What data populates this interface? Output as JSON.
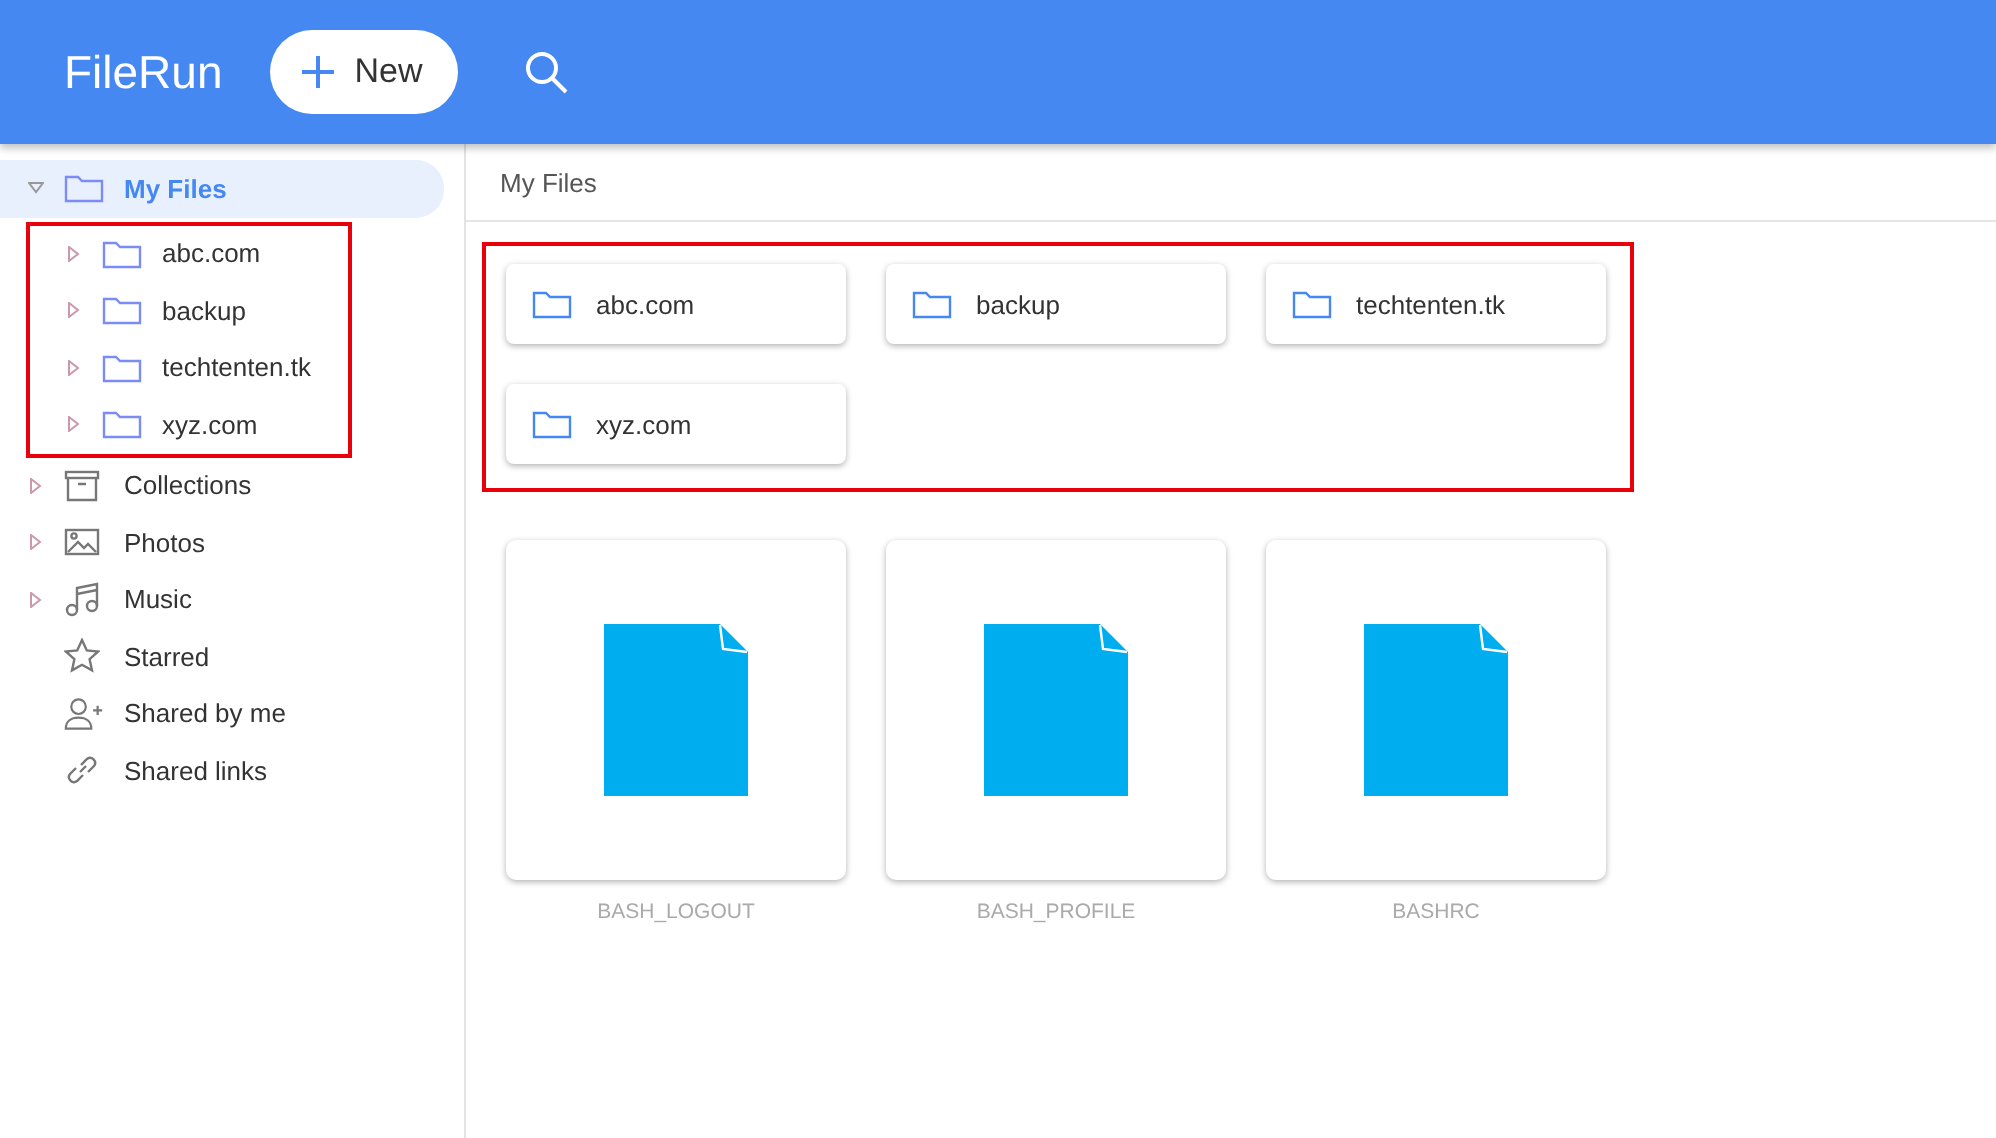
{
  "header": {
    "logo": "FileRun",
    "new_button": "New"
  },
  "sidebar": {
    "items": [
      {
        "label": "My Files",
        "kind": "folder",
        "expandable": true,
        "expanded": true,
        "selected": true,
        "children_highlighted": true,
        "children": [
          {
            "label": "abc.com",
            "kind": "folder",
            "expandable": true,
            "expanded": false,
            "selected": false
          },
          {
            "label": "backup",
            "kind": "folder",
            "expandable": true,
            "expanded": false,
            "selected": false
          },
          {
            "label": "techtenten.tk",
            "kind": "folder",
            "expandable": true,
            "expanded": false,
            "selected": false
          },
          {
            "label": "xyz.com",
            "kind": "folder",
            "expandable": true,
            "expanded": false,
            "selected": false
          }
        ]
      },
      {
        "label": "Collections",
        "kind": "archive",
        "expandable": true,
        "expanded": false,
        "selected": false
      },
      {
        "label": "Photos",
        "kind": "image",
        "expandable": true,
        "expanded": false,
        "selected": false
      },
      {
        "label": "Music",
        "kind": "music",
        "expandable": true,
        "expanded": false,
        "selected": false
      },
      {
        "label": "Starred",
        "kind": "star",
        "expandable": false,
        "selected": false
      },
      {
        "label": "Shared by me",
        "kind": "share",
        "expandable": false,
        "selected": false
      },
      {
        "label": "Shared links",
        "kind": "link",
        "expandable": false,
        "selected": false
      }
    ]
  },
  "breadcrumb": "My Files",
  "folders": {
    "highlighted": true,
    "items": [
      "abc.com",
      "backup",
      "techtenten.tk",
      "xyz.com"
    ]
  },
  "files": [
    "BASH_LOGOUT",
    "BASH_PROFILE",
    "BASHRC"
  ]
}
